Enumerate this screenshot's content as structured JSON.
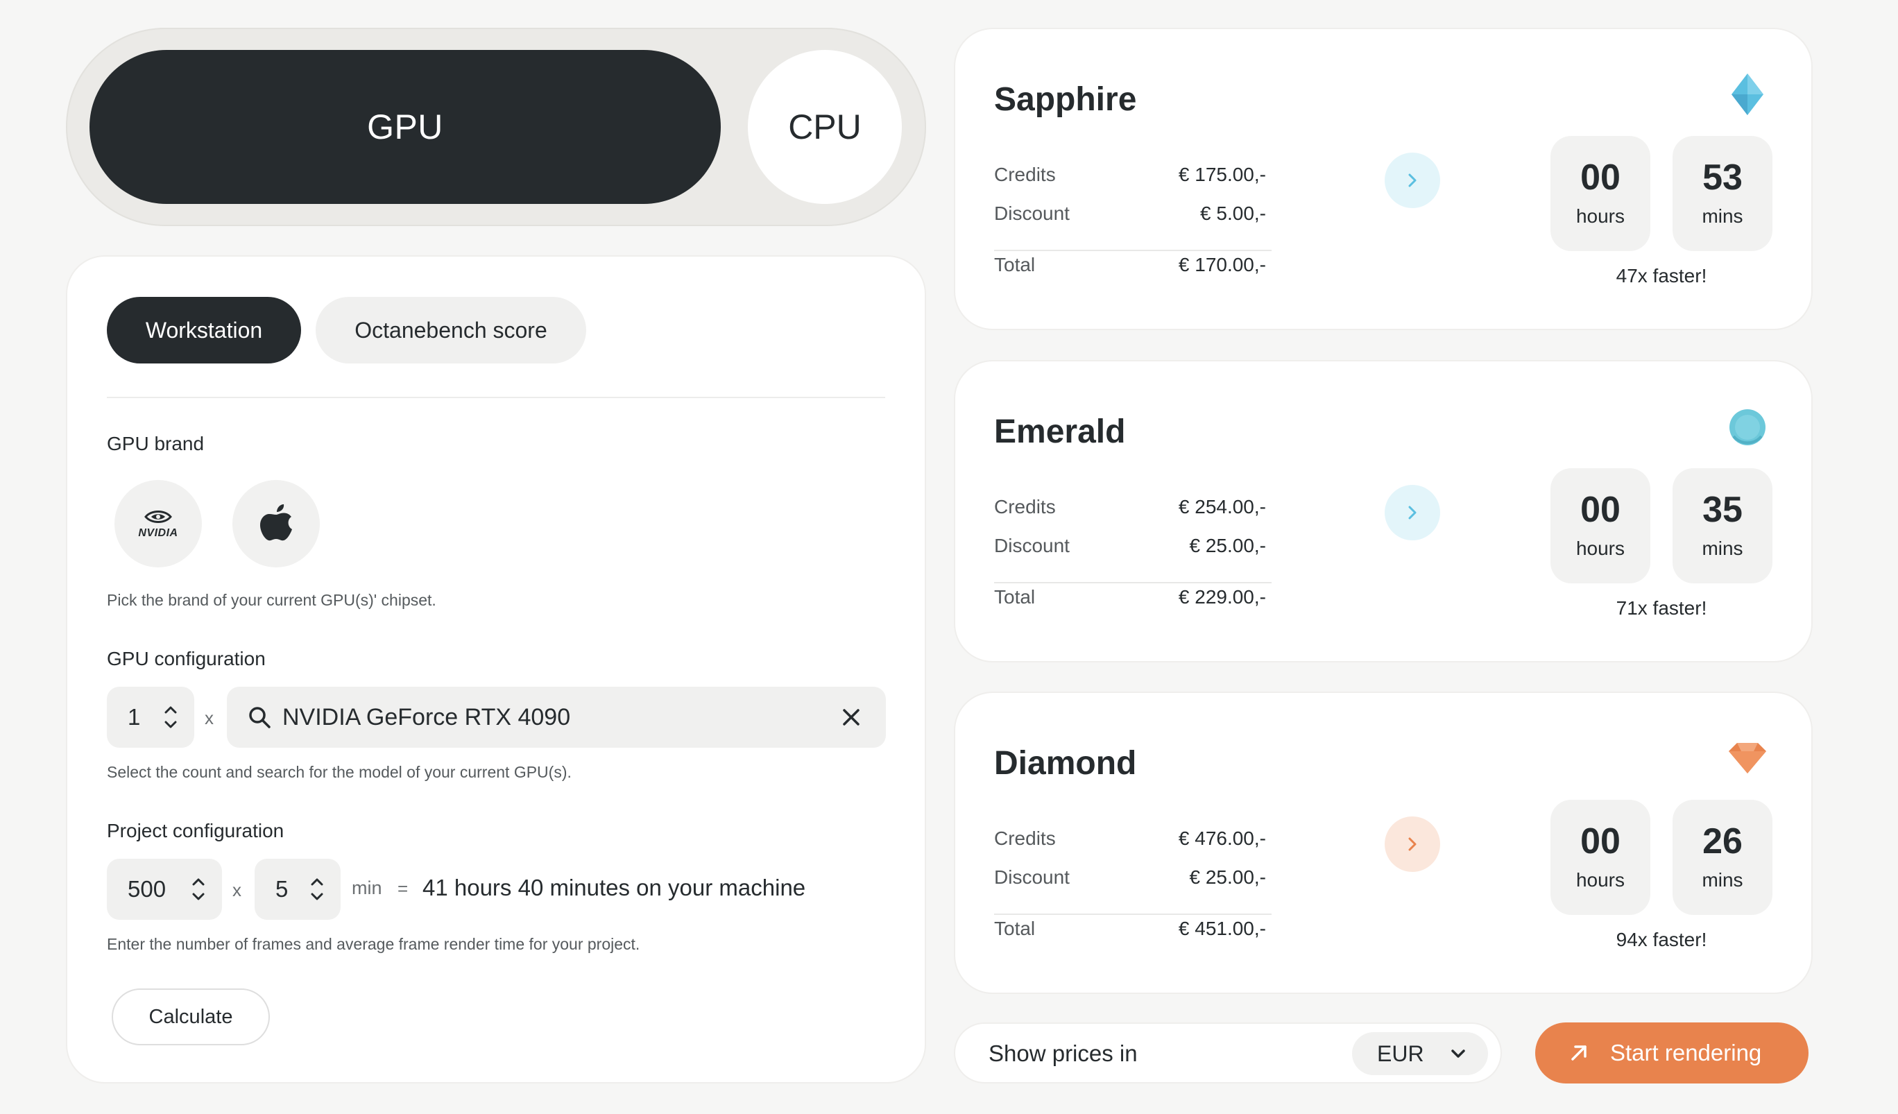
{
  "toggle": {
    "gpu_label": "GPU",
    "cpu_label": "CPU",
    "active": "GPU"
  },
  "tabs": [
    {
      "label": "Workstation",
      "active": true
    },
    {
      "label": "Octanebench score",
      "active": false
    }
  ],
  "gpu_brand": {
    "label": "GPU brand",
    "options": [
      {
        "name": "nvidia",
        "text": "NVIDIA",
        "icon": "nvidia-logo-icon"
      },
      {
        "name": "apple",
        "icon": "apple-logo-icon"
      }
    ],
    "hint": "Pick the brand of your current GPU(s)' chipset."
  },
  "gpu_config": {
    "label": "GPU configuration",
    "count": "1",
    "times": "x",
    "model": "NVIDIA GeForce RTX 4090",
    "hint": "Select the count and search for the model of your current GPU(s)."
  },
  "project_config": {
    "label": "Project configuration",
    "frames": "500",
    "times": "x",
    "frame_time": "5",
    "unit": "min",
    "equals": "=",
    "result": "41 hours 40 minutes on your machine",
    "hint": "Enter the number of frames and average frame render time for your project."
  },
  "calculate_label": "Calculate",
  "plans": [
    {
      "name": "Sapphire",
      "gem": "sapphire-gem-icon",
      "accent": "#5bbfe0",
      "button_bg": "#e3f5fa",
      "credits_label": "Credits",
      "credits": "€ 175.00,-",
      "discount_label": "Discount",
      "discount": "€ 5.00,-",
      "total_label": "Total",
      "total": "€ 170.00,-",
      "hours": "00",
      "hours_label": "hours",
      "mins": "53",
      "mins_label": "mins",
      "faster": "47x faster!"
    },
    {
      "name": "Emerald",
      "gem": "emerald-gem-icon",
      "accent": "#5bbfe0",
      "button_bg": "#e3f5fa",
      "credits_label": "Credits",
      "credits": "€ 254.00,-",
      "discount_label": "Discount",
      "discount": "€ 25.00,-",
      "total_label": "Total",
      "total": "€ 229.00,-",
      "hours": "00",
      "hours_label": "hours",
      "mins": "35",
      "mins_label": "mins",
      "faster": "71x faster!"
    },
    {
      "name": "Diamond",
      "gem": "diamond-gem-icon",
      "accent": "#e8834d",
      "button_bg": "#fbe7dc",
      "credits_label": "Credits",
      "credits": "€ 476.00,-",
      "discount_label": "Discount",
      "discount": "€ 25.00,-",
      "total_label": "Total",
      "total": "€ 451.00,-",
      "hours": "00",
      "hours_label": "hours",
      "mins": "26",
      "mins_label": "mins",
      "faster": "94x faster!"
    }
  ],
  "price_selector": {
    "label": "Show prices in",
    "currency": "EUR"
  },
  "start_label": "Start rendering",
  "colors": {
    "dark": "#262b2e",
    "orange": "#e8834d",
    "cyan": "#5bbfe0"
  }
}
